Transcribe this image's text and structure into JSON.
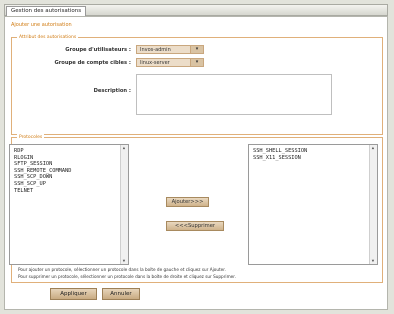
{
  "window": {
    "tab_label": "Gestion des autorisations"
  },
  "form": {
    "section_title": "Ajouter une autorisation",
    "attributes_legend": "Attribut des autorisations",
    "fields": {
      "group_label": "Groupe d'utilisateurs :",
      "group_value": "Invos-admin",
      "target_label": "Groupe de compte cibles :",
      "target_value": "linux-server",
      "description_label": "Description :"
    },
    "protocols_legend": "Protocoles",
    "available": [
      "RDP",
      "RLOGIN",
      "SFTP_SESSION",
      "SSH_REMOTE_COMMAND",
      "SSH_SCP_DOWN",
      "SSH_SCP_UP",
      "TELNET"
    ],
    "selected": [
      "SSH_SHELL_SESSION",
      "SSH_X11_SESSION"
    ],
    "add_button": "Ajouter>>>",
    "remove_button": "<<<Supprimer",
    "help_line1": "Pour ajouter un protocole, sélectionner un protocole dans la boîte de gauche et cliquez sur Ajouter.",
    "help_line2": "Pour supprimer un protocole, sélectionner un protocole dans la boîte de droite et cliquez sur Supprimer.",
    "apply_button": "Appliquer",
    "cancel_button": "Annuler"
  },
  "colors": {
    "accent": "#d07a10",
    "panel_bg": "#ffffff",
    "page_bg": "#e2e3db"
  },
  "icons": {
    "dropdown": "chevron-down-icon",
    "scroll_up": "scroll-up-icon",
    "scroll_down": "scroll-down-icon"
  }
}
